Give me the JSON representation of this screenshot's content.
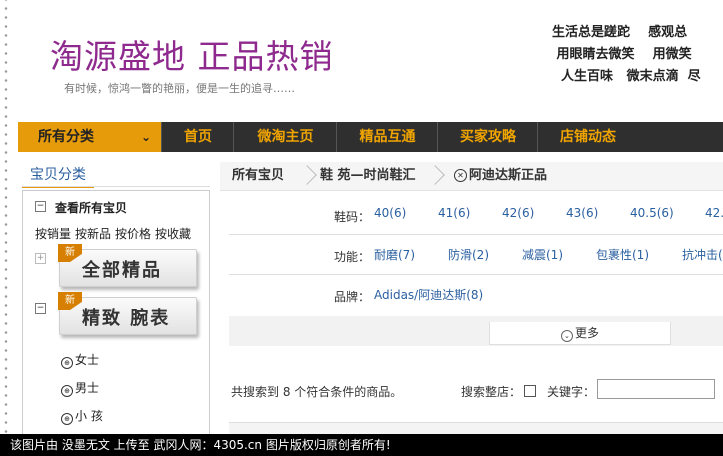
{
  "header": {
    "shop_title": "淘源盛地  正品热销",
    "slogan": "有时候，惊鸿一瞥的艳丽，便是一生的追寻……",
    "poem": "生活总是蹉跎    感观总\n 用眼睛去微笑    用微笑\n  人生百味   微末点滴  尽"
  },
  "nav": {
    "category_label": "所有分类",
    "items": [
      "首页",
      "微淘主页",
      "精品互通",
      "买家攻略",
      "店铺动态"
    ]
  },
  "sidebar": {
    "tab_label": "宝贝分类",
    "view_all": "查看所有宝贝",
    "sort_links": [
      "按销量",
      "按新品",
      "按价格",
      "按收藏"
    ],
    "banners": [
      {
        "new_tag": "新",
        "text": "全部精品"
      },
      {
        "new_tag": "新",
        "text": "精致 腕表"
      }
    ],
    "sub_items": [
      "女士",
      "男士",
      "小 孩"
    ]
  },
  "breadcrumb": {
    "items": [
      "所有宝贝",
      "鞋 苑—时尚鞋汇",
      "阿迪达斯正品"
    ]
  },
  "filters": [
    {
      "label": "鞋码：",
      "values": [
        "40(6)",
        "41(6)",
        "42(6)",
        "43(6)",
        "40.5(6)",
        "42."
      ]
    },
    {
      "label": "功能：",
      "values": [
        "耐磨(7)",
        "防滑(2)",
        "减震(1)",
        "包裹性(1)",
        "抗冲击("
      ]
    },
    {
      "label": "品牌：",
      "values": [
        "Adidas/阿迪达斯(8)"
      ]
    }
  ],
  "more_label": "更多",
  "results": {
    "count_text": "共搜索到 8 个符合条件的商品。",
    "search_store_label": "搜索整店：",
    "keyword_label": "关键字：",
    "keyword_value": ""
  },
  "caption": "该图片由 没墨无文 上传至 武冈人网：4305.cn 图片版权归原创者所有!",
  "colors": {
    "title_purple": "#8e2a8e",
    "nav_bg": "#2f2f2f",
    "nav_accent": "#e59b0a",
    "link_blue": "#2a5fa0"
  }
}
